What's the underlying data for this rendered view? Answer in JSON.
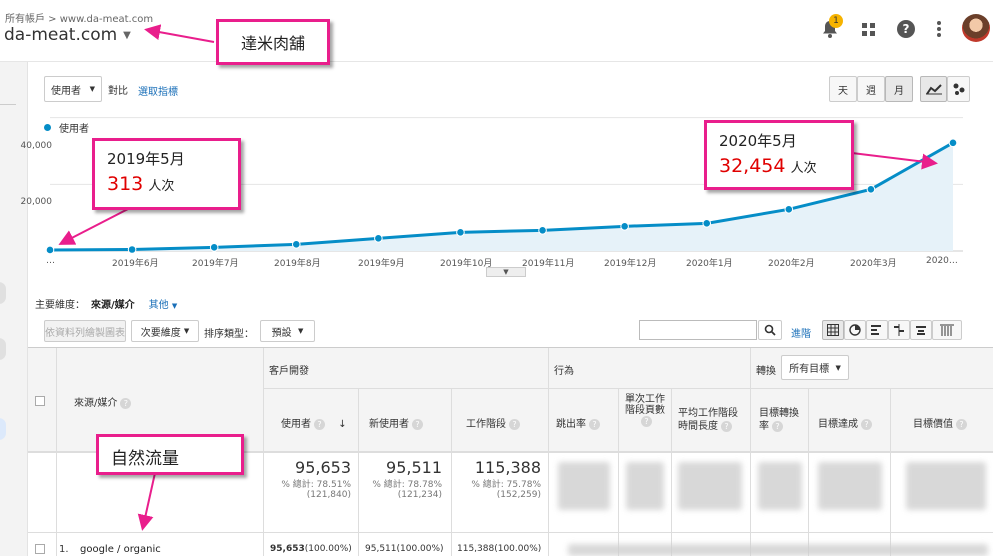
{
  "header": {
    "breadcrumb": "所有帳戶 > www.da-meat.com",
    "property": "da-meat.com",
    "notif_count": "1"
  },
  "toolbar": {
    "metric_select": "使用者",
    "compare_label": "對比",
    "choose_metric": "選取指標",
    "period_day": "天",
    "period_week": "週",
    "period_month": "月"
  },
  "chart": {
    "legend": "使用者",
    "yticks": [
      "40,000",
      "20,000"
    ],
    "xticks": [
      "…",
      "2019年6月",
      "2019年7月",
      "2019年8月",
      "2019年9月",
      "2019年10月",
      "2019年11月",
      "2019年12月",
      "2020年1月",
      "2020年2月",
      "2020年3月",
      "2020…"
    ]
  },
  "chart_data": {
    "type": "area",
    "series": [
      {
        "name": "使用者",
        "values": [
          313,
          450,
          1100,
          2000,
          3800,
          5600,
          6200,
          7400,
          8300,
          12500,
          18500,
          32454
        ]
      }
    ],
    "categories": [
      "2019年5月",
      "2019年6月",
      "2019年7月",
      "2019年8月",
      "2019年9月",
      "2019年10月",
      "2019年11月",
      "2019年12月",
      "2020年1月",
      "2020年2月",
      "2020年3月",
      "2020年5月"
    ],
    "ylim": [
      0,
      45000
    ],
    "color": "#058dc7"
  },
  "callouts": {
    "site_name": "達米肉舖",
    "start_date": "2019年5月",
    "start_value": "313",
    "start_unit": "人次",
    "end_date": "2020年5月",
    "end_value": "32,454",
    "end_unit": "人次",
    "organic": "自然流量"
  },
  "dimensions": {
    "label": "主要維度：",
    "current": "來源/媒介",
    "other": "其他"
  },
  "controls": {
    "plot_rows": "依資料列繪製圖表",
    "secondary": "次要維度",
    "sort_label": "排序類型：",
    "sort_value": "預設",
    "advanced": "進階"
  },
  "table": {
    "col_dimension": "來源/媒介",
    "group_acquisition": "客戶開發",
    "group_behavior": "行為",
    "group_conversion": "轉換",
    "goal_select": "所有目標",
    "headers": [
      "使用者",
      "新使用者",
      "工作階段",
      "跳出率",
      "單次工作階段頁數",
      "平均工作階段時間長度",
      "目標轉換率",
      "目標達成",
      "目標價值"
    ],
    "totals": {
      "users": "95,653",
      "users_pct": "% 總計: 78.51%",
      "users_total": "(121,840)",
      "new_users": "95,511",
      "new_users_pct": "% 總計: 78.78%",
      "new_users_total": "(121,234)",
      "sessions": "115,388",
      "sessions_pct": "% 總計: 75.78%",
      "sessions_total": "(152,259)"
    },
    "rows": [
      {
        "index": "1.",
        "source": "google / organic",
        "users": "95,653",
        "users_pct": "(100.00%)",
        "new_users": "95,511",
        "new_users_pct": "(100.00%)",
        "sessions": "115,388",
        "sessions_pct": "(100.00%)"
      }
    ]
  },
  "colors": {
    "accent": "#e91e8c",
    "line": "#058dc7",
    "red": "#e00000"
  }
}
